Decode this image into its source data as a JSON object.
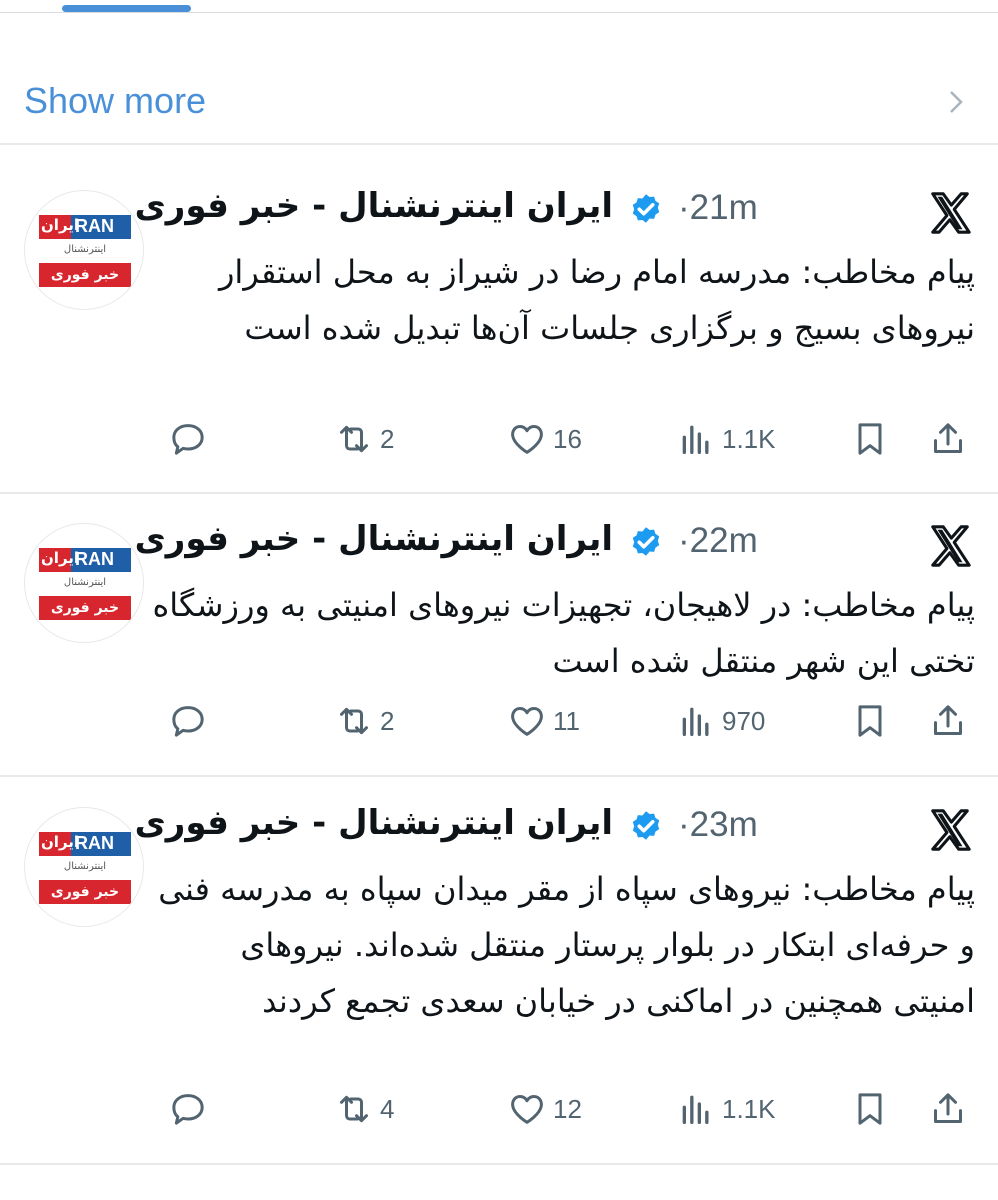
{
  "show_more": {
    "label": "Show more"
  },
  "tweets": [
    {
      "author": "ایران اینترنشنال - خبر فوری",
      "time": "21m",
      "text": "پیام مخاطب: مدرسه امام رضا در شیراز به محل استقرار نیروهای بسیج و برگزاری جلسات آن‌ها تبدیل شده است",
      "retweets": "2",
      "likes": "16",
      "views": "1.1K"
    },
    {
      "author": "ایران اینترنشنال - خبر فوری",
      "time": "22m",
      "text": "پیام مخاطب: در لاهیجان، تجهیزات نیروهای امنیتی به ورزشگاه تختی این شهر منتقل شده است",
      "retweets": "2",
      "likes": "11",
      "views": "970"
    },
    {
      "author": "ایران اینترنشنال - خبر فوری",
      "time": "23m",
      "text": "پیام مخاطب: نیروهای سپاه از مقر میدان سپاه به مدرسه فنی و حرفه‌ای ابتکار در بلوار پرستار منتقل شده‌اند. نیروهای امنیتی همچنین در اماکنی در خیابان سعدی تجمع کردند",
      "retweets": "4",
      "likes": "12",
      "views": "1.1K"
    }
  ],
  "avatar_logo": {
    "ran": "RAN",
    "iran": "ایران",
    "sub": "اینترنشنال",
    "bottom": "خبر فوری"
  },
  "colors": {
    "accent": "#4a90d9",
    "verified": "#1d9bf0",
    "muted": "#536471",
    "logo_red": "#d7262d",
    "logo_blue": "#1f5fa8"
  },
  "icons": [
    "chevron-right-icon",
    "x-logo-icon",
    "verified-badge-icon",
    "reply-icon",
    "retweet-icon",
    "like-icon",
    "views-icon",
    "bookmark-icon",
    "share-icon"
  ]
}
